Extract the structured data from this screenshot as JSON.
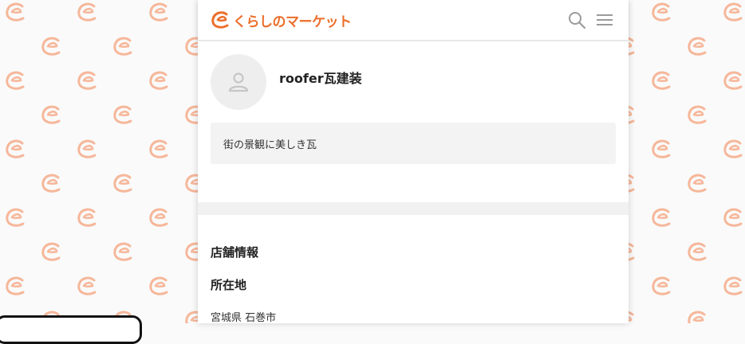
{
  "header": {
    "logo_text": "くらしのマーケット",
    "logo_icon": "c-mascot-icon",
    "search_icon": "search-icon",
    "menu_icon": "hamburger-menu-icon"
  },
  "profile": {
    "avatar_icon": "user-silhouette-icon",
    "shop_name": "roofer瓦建装",
    "description": "街の景観に美しき瓦"
  },
  "store_info": {
    "section_title": "店舗情報",
    "location_label": "所在地",
    "location_value": "宮城県 石巻市"
  },
  "colors": {
    "brand_orange": "#ec6e2a",
    "pattern_orange": "#f6b79a"
  }
}
